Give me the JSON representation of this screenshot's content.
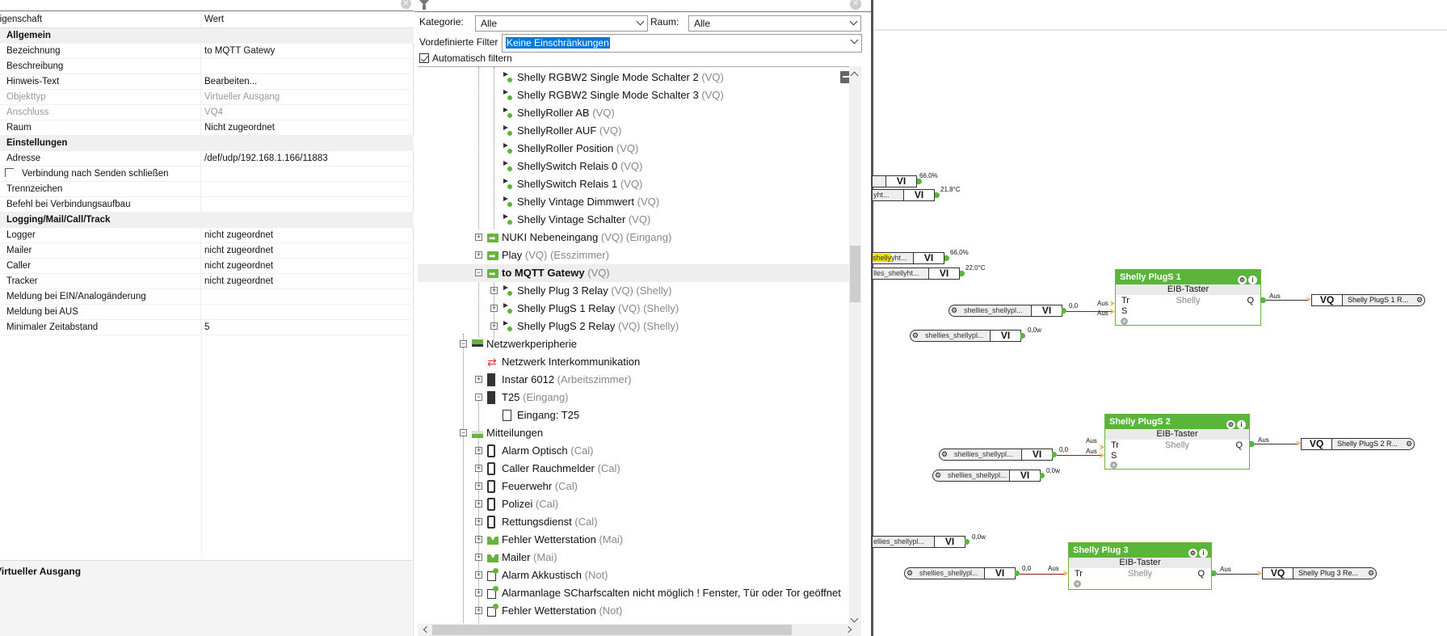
{
  "properties": {
    "header": {
      "key": "Eigenschaft",
      "value": "Wert"
    },
    "rows": [
      {
        "type": "section",
        "key": "Allgemein",
        "value": ""
      },
      {
        "type": "row",
        "key": "Bezeichnung",
        "value": "to MQTT Gatewy"
      },
      {
        "type": "row",
        "key": "Beschreibung",
        "value": ""
      },
      {
        "type": "row",
        "key": "Hinweis-Text",
        "value": "Bearbeiten..."
      },
      {
        "type": "disabled",
        "key": "Objekttyp",
        "value": "Virtueller Ausgang"
      },
      {
        "type": "disabled",
        "key": "Anschluss",
        "value": "VQ4"
      },
      {
        "type": "row",
        "key": "Raum",
        "value": "Nicht zugeordnet"
      },
      {
        "type": "section",
        "key": "Einstellungen",
        "value": ""
      },
      {
        "type": "row",
        "key": "Adresse",
        "value": "/def/udp/192.168.1.166/11883"
      },
      {
        "type": "checkbox",
        "key": "Verbindung nach Senden schließen",
        "value": "",
        "checked": false
      },
      {
        "type": "row",
        "key": "Trennzeichen",
        "value": ""
      },
      {
        "type": "row",
        "key": "Befehl bei Verbindungsaufbau",
        "value": ""
      },
      {
        "type": "section",
        "key": "Logging/Mail/Call/Track",
        "value": ""
      },
      {
        "type": "row",
        "key": "Logger",
        "value": "nicht zugeordnet"
      },
      {
        "type": "row",
        "key": "Mailer",
        "value": "nicht zugeordnet"
      },
      {
        "type": "row",
        "key": "Caller",
        "value": "nicht zugeordnet"
      },
      {
        "type": "row",
        "key": "Tracker",
        "value": "nicht zugeordnet"
      },
      {
        "type": "row",
        "key": "Meldung bei EIN/Analogänderung",
        "value": ""
      },
      {
        "type": "row",
        "key": "Meldung bei AUS",
        "value": ""
      },
      {
        "type": "row",
        "key": "Minimaler Zeitabstand",
        "value": "5"
      }
    ],
    "description_title": "Virtueller Ausgang"
  },
  "filter": {
    "category_label": "Kategorie:",
    "category_value": "Alle",
    "room_label": "Raum:",
    "room_value": "Alle",
    "predefined_label": "Vordefinierte Filter",
    "predefined_value": "Keine Einschränkungen",
    "auto_filter_label": "Automatisch filtern",
    "auto_filter_checked": true
  },
  "tree": [
    {
      "depth": 2,
      "expander": null,
      "icon": "vq",
      "label": "Shelly RGBW2 Single Mode Schalter 2",
      "suffix": "(VQ)"
    },
    {
      "depth": 2,
      "expander": null,
      "icon": "vq",
      "label": "Shelly RGBW2 Single Mode Schalter 3",
      "suffix": "(VQ)"
    },
    {
      "depth": 2,
      "expander": null,
      "icon": "vq",
      "label": "ShellyRoller AB",
      "suffix": "(VQ)"
    },
    {
      "depth": 2,
      "expander": null,
      "icon": "vq",
      "label": "ShellyRoller AUF",
      "suffix": "(VQ)"
    },
    {
      "depth": 2,
      "expander": null,
      "icon": "vq",
      "label": "ShellyRoller Position",
      "suffix": "(VQ)"
    },
    {
      "depth": 2,
      "expander": null,
      "icon": "vq",
      "label": "ShellySwitch Relais 0",
      "suffix": "(VQ)"
    },
    {
      "depth": 2,
      "expander": null,
      "icon": "vq",
      "label": "ShellySwitch Relais 1",
      "suffix": "(VQ)"
    },
    {
      "depth": 2,
      "expander": null,
      "icon": "vq",
      "label": "Shelly Vintage Dimmwert",
      "suffix": "(VQ)"
    },
    {
      "depth": 2,
      "expander": null,
      "icon": "vq",
      "label": "Shelly Vintage Schalter",
      "suffix": "(VQ)"
    },
    {
      "depth": 1,
      "expander": "plus",
      "icon": "vqfolder",
      "label": "NUKI Nebeneingang",
      "suffix": "(VQ) (Eingang)"
    },
    {
      "depth": 1,
      "expander": "plus",
      "icon": "vqfolder",
      "label": "Play",
      "suffix": "(VQ) (Esszimmer)"
    },
    {
      "depth": 1,
      "expander": "minus",
      "icon": "vqfolder",
      "label": "to MQTT Gatewy",
      "suffix": "(VQ)",
      "selected": true
    },
    {
      "depth": 2,
      "expander": "plus",
      "icon": "vq",
      "label": "Shelly Plug 3 Relay",
      "suffix": "(VQ) (Shelly)"
    },
    {
      "depth": 2,
      "expander": "plus",
      "icon": "vq",
      "label": "Shelly PlugS 1 Relay",
      "suffix": "(VQ) (Shelly)"
    },
    {
      "depth": 2,
      "expander": "plus",
      "icon": "vq",
      "label": "Shelly PlugS 2 Relay",
      "suffix": "(VQ) (Shelly)"
    },
    {
      "depth": 0,
      "expander": "minus",
      "icon": "net",
      "label": "Netzwerkperipherie",
      "suffix": ""
    },
    {
      "depth": 1,
      "expander": null,
      "icon": "inter",
      "label": "Netzwerk Interkommunikation",
      "suffix": ""
    },
    {
      "depth": 1,
      "expander": "plus",
      "icon": "dev",
      "label": "Instar 6012",
      "suffix": "(Arbeitszimmer)"
    },
    {
      "depth": 1,
      "expander": "minus",
      "icon": "dev",
      "label": "T25",
      "suffix": "(Eingang)"
    },
    {
      "depth": 2,
      "expander": null,
      "icon": "doc",
      "label": "Eingang: T25",
      "suffix": ""
    },
    {
      "depth": 0,
      "expander": "minus",
      "icon": "log",
      "label": "Mitteilungen",
      "suffix": ""
    },
    {
      "depth": 1,
      "expander": "plus",
      "icon": "phone",
      "label": "Alarm Optisch",
      "suffix": "(Cal)"
    },
    {
      "depth": 1,
      "expander": "plus",
      "icon": "phone",
      "label": "Caller Rauchmelder",
      "suffix": "(Cal)"
    },
    {
      "depth": 1,
      "expander": "plus",
      "icon": "phone",
      "label": "Feuerwehr",
      "suffix": "(Cal)"
    },
    {
      "depth": 1,
      "expander": "plus",
      "icon": "phone",
      "label": "Polizei",
      "suffix": "(Cal)"
    },
    {
      "depth": 1,
      "expander": "plus",
      "icon": "phone",
      "label": "Rettungsdienst",
      "suffix": "(Cal)"
    },
    {
      "depth": 1,
      "expander": "plus",
      "icon": "mail",
      "label": "Fehler Wetterstation",
      "suffix": "(Mai)"
    },
    {
      "depth": 1,
      "expander": "plus",
      "icon": "mail",
      "label": "Mailer",
      "suffix": "(Mai)"
    },
    {
      "depth": 1,
      "expander": "plus",
      "icon": "not",
      "label": "Alarm Akkustisch",
      "suffix": "(Not)"
    },
    {
      "depth": 1,
      "expander": "plus",
      "icon": "not",
      "label": "Alarmanlage SCharfscalten nicht möglich ! Fenster, Tür oder Tor geöffnet",
      "suffix": ""
    },
    {
      "depth": 1,
      "expander": "plus",
      "icon": "not",
      "label": "Fehler Wetterstation",
      "suffix": "(Not)"
    }
  ],
  "canvas": {
    "inputs": [
      {
        "name": "",
        "tag": "VI",
        "value": "66,0%"
      },
      {
        "name": "yht...",
        "tag": "VI",
        "value": "21,8°C"
      },
      {
        "name_highlight": "shelly",
        "name": "yht...",
        "tag": "VI",
        "value": "66,0%"
      },
      {
        "name": "lles_shellyht...",
        "tag": "VI",
        "value": "22,0°C"
      },
      {
        "name": "shellies_shellypl...",
        "tag": "VI",
        "value": "0,0"
      },
      {
        "name": "shellies_shellypl...",
        "tag": "VI",
        "value": "0,0w"
      },
      {
        "name": "shellies_shellypl...",
        "tag": "VI",
        "value": "0,0"
      },
      {
        "name": "shellies_shellypl...",
        "tag": "VI",
        "value": "0,0w"
      },
      {
        "name": "ellies_shellypl...",
        "tag": "VI",
        "value": "0,0w"
      },
      {
        "name": "shellies_shellypl...",
        "tag": "VI",
        "value": "0,0"
      }
    ],
    "blocks": [
      {
        "title": "Shelly PlugS 1",
        "type": "EIB-Taster",
        "room": "Shelly",
        "pin_tr": "Tr",
        "pin_s": "S",
        "pin_q": "Q",
        "in_tr": "Aus",
        "in_s": "Aus",
        "out_q": "Aus",
        "output_tag": "VQ",
        "output_name": "Shelly PlugS 1 R..."
      },
      {
        "title": "Shelly PlugS 2",
        "type": "EIB-Taster",
        "room": "Shelly",
        "pin_tr": "Tr",
        "pin_s": "S",
        "pin_q": "Q",
        "in_tr": "Aus",
        "in_s": "Aus",
        "out_q": "Aus",
        "output_tag": "VQ",
        "output_name": "Shelly PlugS 2 R..."
      },
      {
        "title": "Shelly Plug 3",
        "type": "EIB-Taster",
        "room": "Shelly",
        "pin_tr": "Tr",
        "pin_q": "Q",
        "in_tr": "Aus",
        "out_q": "Aus",
        "output_tag": "VQ",
        "output_name": "Shelly Plug 3 Re..."
      }
    ]
  },
  "colors": {
    "accent_green": "#5bb53b",
    "selection_blue": "#0078d7",
    "port_orange": "#f4b25a"
  }
}
